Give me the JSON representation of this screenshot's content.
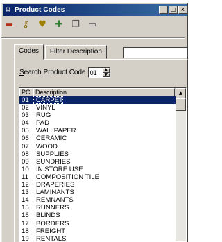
{
  "window": {
    "title": "Product Codes",
    "title_icon": "gear-icon",
    "buttons": [
      "_",
      "□",
      "x"
    ]
  },
  "toolbar": {
    "tools": [
      {
        "name": "exit-icon",
        "glyph": "▬",
        "color": "#b0301c"
      },
      {
        "name": "key-icon",
        "glyph": "⚷",
        "color": "#806000"
      },
      {
        "name": "heart-key-icon",
        "glyph": "♥",
        "color": "#a08000"
      },
      {
        "name": "new-record-icon",
        "glyph": "✚",
        "color": "#2f7f2f"
      },
      {
        "name": "copy-icon",
        "glyph": "❐",
        "color": "#5a5a5a"
      },
      {
        "name": "document-icon",
        "glyph": "▭",
        "color": "#5a5a5a"
      }
    ]
  },
  "tabs": {
    "codes_label": "Codes",
    "filter_label": "Filter Description"
  },
  "filter": {
    "value": ""
  },
  "search": {
    "label_prefix": "S",
    "label_rest": "earch Product Code",
    "value": "01"
  },
  "list": {
    "headers": {
      "pc": "PC",
      "description": "Description"
    },
    "rows": [
      {
        "pc": "01",
        "description": "CARPET"
      },
      {
        "pc": "02",
        "description": "VINYL"
      },
      {
        "pc": "03",
        "description": "RUG"
      },
      {
        "pc": "04",
        "description": "PAD"
      },
      {
        "pc": "05",
        "description": "WALLPAPER"
      },
      {
        "pc": "06",
        "description": "CERAMIC"
      },
      {
        "pc": "07",
        "description": "WOOD"
      },
      {
        "pc": "08",
        "description": "SUPPLIES"
      },
      {
        "pc": "09",
        "description": "SUNDRIES"
      },
      {
        "pc": "10",
        "description": "IN STORE USE"
      },
      {
        "pc": "11",
        "description": "COMPOSITION TILE"
      },
      {
        "pc": "12",
        "description": "DRAPERIES"
      },
      {
        "pc": "13",
        "description": "LAMINANTS"
      },
      {
        "pc": "14",
        "description": "REMNANTS"
      },
      {
        "pc": "15",
        "description": "RUNNERS"
      },
      {
        "pc": "16",
        "description": "BLINDS"
      },
      {
        "pc": "17",
        "description": "BORDERS"
      },
      {
        "pc": "18",
        "description": "FREIGHT"
      },
      {
        "pc": "19",
        "description": "RENTALS"
      }
    ],
    "selected_index": 0
  },
  "colors": {
    "titlebar": "#0a246a",
    "selection": "#0a246a",
    "face": "#d4d0c8"
  }
}
